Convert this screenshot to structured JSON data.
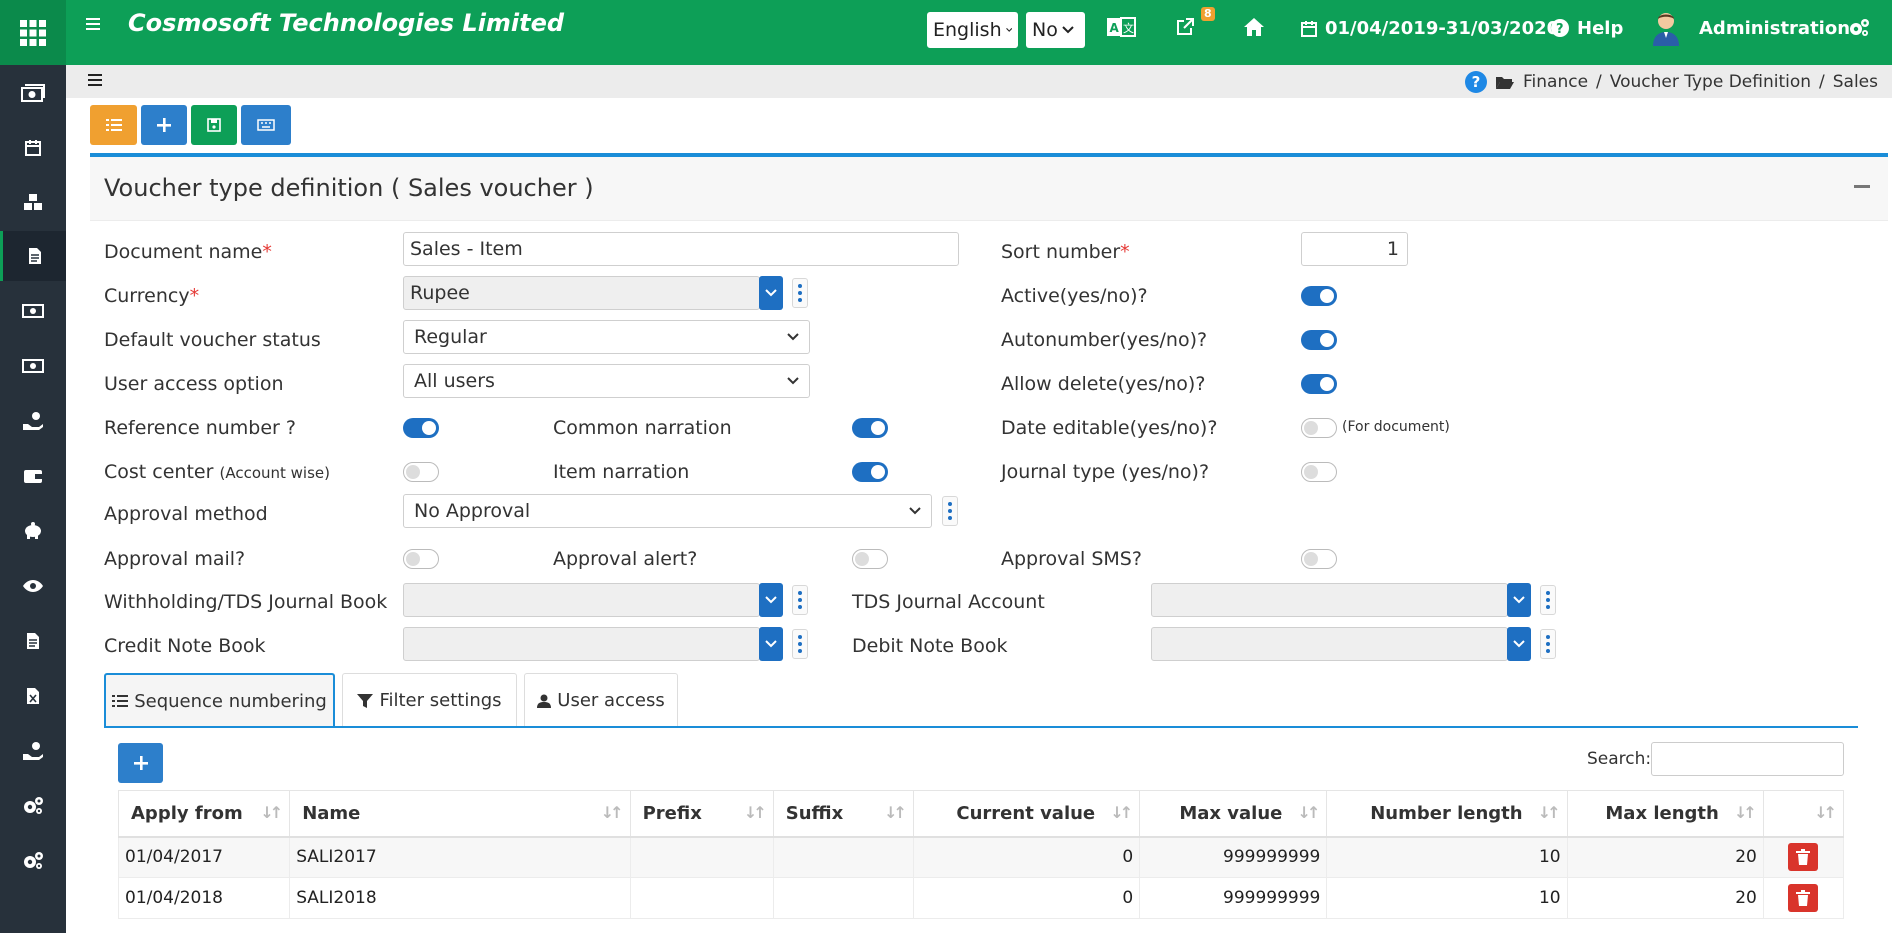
{
  "header": {
    "company": "Cosmosoft Technologies Limited",
    "language": "English",
    "yes_no": "No",
    "notification_count": "8",
    "fiscal_period": "01/04/2019-31/03/2020",
    "help_label": "Help",
    "user_name": "Administration"
  },
  "breadcrumb": {
    "items": [
      "Finance",
      "Voucher Type Definition",
      "Sales"
    ],
    "sep": "/"
  },
  "panel": {
    "title": "Voucher type definition ( Sales voucher )"
  },
  "form": {
    "document_name_label": "Document name",
    "document_name_value": "Sales - Item",
    "sort_number_label": "Sort number",
    "sort_number_value": "1",
    "currency_label": "Currency",
    "currency_value": "Rupee",
    "active_label": "Active(yes/no)?",
    "active": true,
    "default_status_label": "Default voucher status",
    "default_status_value": "Regular",
    "autonumber_label": "Autonumber(yes/no)?",
    "autonumber": true,
    "user_access_label": "User access option",
    "user_access_value": "All users",
    "allow_delete_label": "Allow delete(yes/no)?",
    "allow_delete": true,
    "reference_number_label": "Reference number ?",
    "reference_number": true,
    "common_narration_label": "Common narration",
    "common_narration": true,
    "date_editable_label": "Date editable(yes/no)?",
    "date_editable": false,
    "date_editable_note": "(For document)",
    "cost_center_label": "Cost center",
    "cost_center_note": "(Account wise)",
    "cost_center": false,
    "item_narration_label": "Item narration",
    "item_narration": true,
    "journal_type_label": "Journal type (yes/no)?",
    "journal_type": false,
    "approval_method_label": "Approval method",
    "approval_method_value": "No Approval",
    "approval_mail_label": "Approval mail?",
    "approval_mail": false,
    "approval_alert_label": "Approval alert?",
    "approval_alert": false,
    "approval_sms_label": "Approval SMS?",
    "approval_sms": false,
    "tds_book_label": "Withholding/TDS Journal Book",
    "tds_account_label": "TDS Journal Account",
    "credit_note_label": "Credit Note Book",
    "debit_note_label": "Debit Note Book"
  },
  "tabs": [
    {
      "label": "Sequence numbering",
      "icon": "list-ol-icon",
      "active": true
    },
    {
      "label": "Filter settings",
      "icon": "filter-icon",
      "active": false
    },
    {
      "label": "User access",
      "icon": "user-icon",
      "active": false
    }
  ],
  "table": {
    "search_label": "Search:",
    "columns": [
      "Apply from",
      "Name",
      "Prefix",
      "Suffix",
      "Current value",
      "Max value",
      "Number length",
      "Max length"
    ],
    "rows": [
      {
        "apply_from": "01/04/2017",
        "name": "SALI2017",
        "prefix": "",
        "suffix": "",
        "current_value": "0",
        "max_value": "999999999",
        "number_length": "10",
        "max_length": "20"
      },
      {
        "apply_from": "01/04/2018",
        "name": "SALI2018",
        "prefix": "",
        "suffix": "",
        "current_value": "0",
        "max_value": "999999999",
        "number_length": "10",
        "max_length": "20"
      }
    ]
  },
  "colors": {
    "brand_green": "#0d9f57",
    "sidebar": "#27313b",
    "primary_blue": "#1e6fc2",
    "accent_orange": "#f0a030",
    "danger_red": "#d9342b"
  }
}
